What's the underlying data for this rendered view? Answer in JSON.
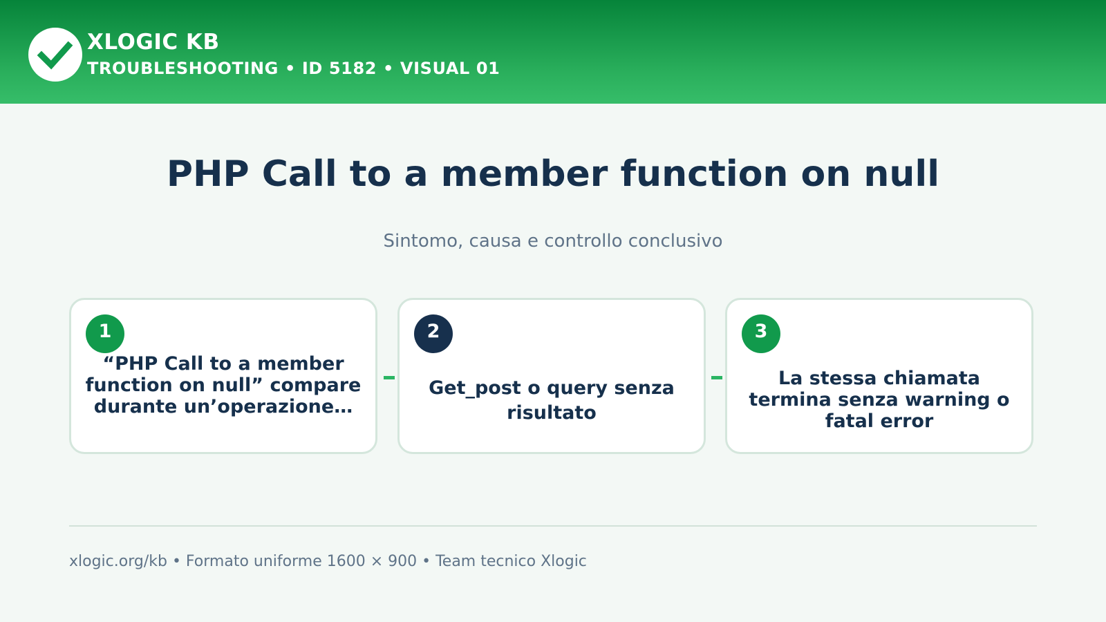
{
  "header": {
    "brand": "XLOGIC KB",
    "subtitle": "TROUBLESHOOTING • ID 5182 • VISUAL 01",
    "logo_icon": "checkmark-icon"
  },
  "main": {
    "title": "PHP Call to a member function on null",
    "subtitle": "Sintomo, causa e controllo conclusivo"
  },
  "steps": [
    {
      "number": "1",
      "text": "“PHP Call to a member function on null” compare durante un’operazione…",
      "badge_color": "#119a4c"
    },
    {
      "number": "2",
      "text": "Get_post o query senza risultato",
      "badge_color": "#17304d"
    },
    {
      "number": "3",
      "text": "La stessa chiamata termina senza warning o fatal error",
      "badge_color": "#119a4c"
    }
  ],
  "footer": {
    "text": "xlogic.org/kb • Formato uniforme 1600 × 900 • Team tecnico Xlogic"
  },
  "colors": {
    "header_dark": "#06843a",
    "header_light": "#36bd69",
    "accent": "#2bb564",
    "navy": "#16304c",
    "muted": "#5f7388",
    "background": "#f3f8f5"
  }
}
